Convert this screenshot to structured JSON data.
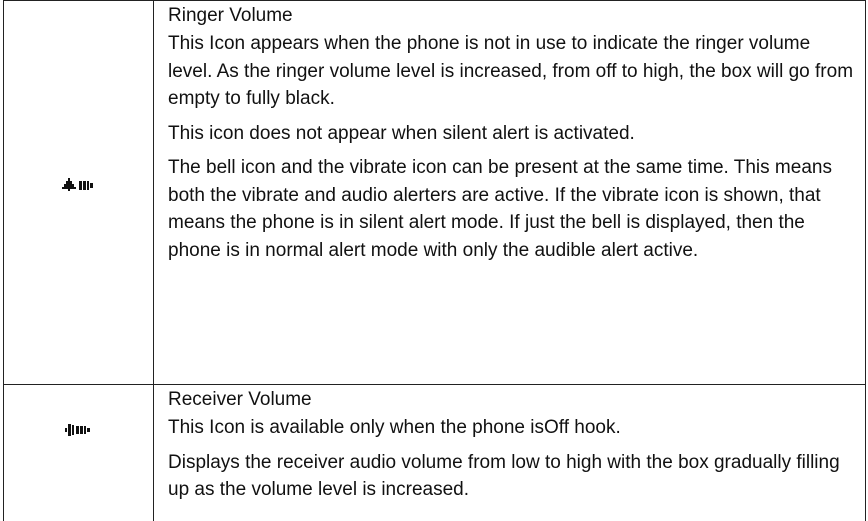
{
  "rows": [
    {
      "title": "Ringer Volume",
      "icon": "bell-volume-icon",
      "paragraphs": [
        "This Icon appears when the phone is not in use to indicate the ringer volume level.  As the ringer volume level is increased, from off to high, the box will go from empty to fully black.",
        "This icon does not appear when silent alert is activated.",
        "The bell icon and the vibrate icon can be present at the same time.  This means both the vibrate and audio alerters are active.  If the vibrate icon is shown, that means the phone is in silent alert mode.  If just the bell is displayed, then the phone is in normal alert mode with only the audible alert active."
      ]
    },
    {
      "title": "Receiver Volume",
      "icon": "speaker-volume-icon",
      "paragraphs": [
        "This Icon is available only when the phone isOff hook.",
        "Displays the receiver audio volume from low to high with the box gradually filling up as the volume level is increased."
      ]
    }
  ]
}
